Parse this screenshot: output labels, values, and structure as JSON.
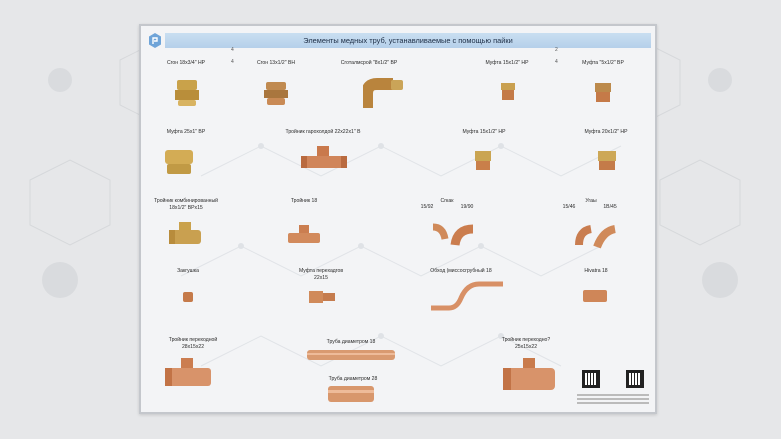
{
  "header": {
    "title": "Элементы медных труб, устанавливаемые с помощью пайки"
  },
  "labels": {
    "r1a": "Сгон 18х3/4\" НР",
    "r1b": "Сгон 13х1/2\" ВН",
    "r1c": "Сготалмсрой \"8х1/2\" ВР",
    "r1d": "Муфта 15х1/2\" НР",
    "r1e": "Муфта \"5х1/2\" ВР",
    "r2a": "Муфта 25х1\" ВР",
    "r2b": "Тройник гарохолдой 22х22х1\" В",
    "r2c": "Муфта 15х1/2\" НР",
    "r2d": "Муфта 20х1/2\" НР",
    "r3a1": "Тройник комбинированный",
    "r3a2": "18х1/2\" ВРх15",
    "r3b": "Тройник 18",
    "r3c": "Сгкак",
    "r3c1": "15/92",
    "r3c2": "19/90",
    "r3d": "Угаы",
    "r3d1": "15/46",
    "r3d2": "1В/45",
    "r4a": "Закгушка",
    "r4b1": "Муфта перехадгов",
    "r4b2": "22х15",
    "r4c": "Обход (миссосгрубный 18",
    "r4d": "Нivatra 18",
    "r5a1": "Тройник переходной",
    "r5a2": "28х15х22",
    "r5b": "Труба диаметром 18",
    "r5c": "Труба диаметром 28",
    "r5d1": "Тройник переходно?",
    "r5d2": "25х15х22"
  },
  "markers": [
    "4",
    "4",
    "2",
    "4"
  ],
  "colors": {
    "brass": "#c9a24a",
    "copper": "#c97a4e",
    "header": "#c2d9ef"
  }
}
